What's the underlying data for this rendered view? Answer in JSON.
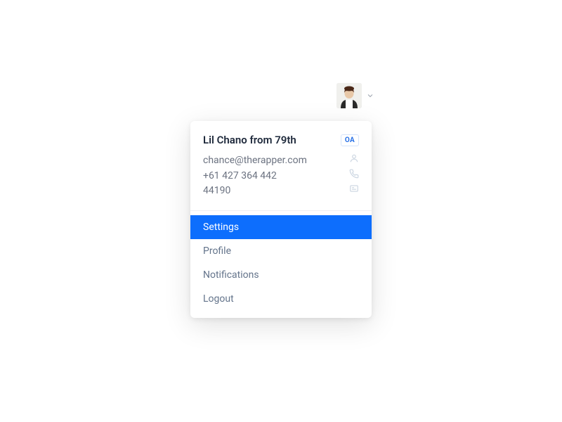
{
  "user": {
    "name": "Lil Chano from 79th",
    "badge": "OA",
    "email": "chance@therapper.com",
    "phone": "+61 427 364 442",
    "code": "44190"
  },
  "menu": {
    "items": [
      {
        "label": "Settings",
        "active": true
      },
      {
        "label": "Profile",
        "active": false
      },
      {
        "label": "Notifications",
        "active": false
      },
      {
        "label": "Logout",
        "active": false
      }
    ]
  }
}
